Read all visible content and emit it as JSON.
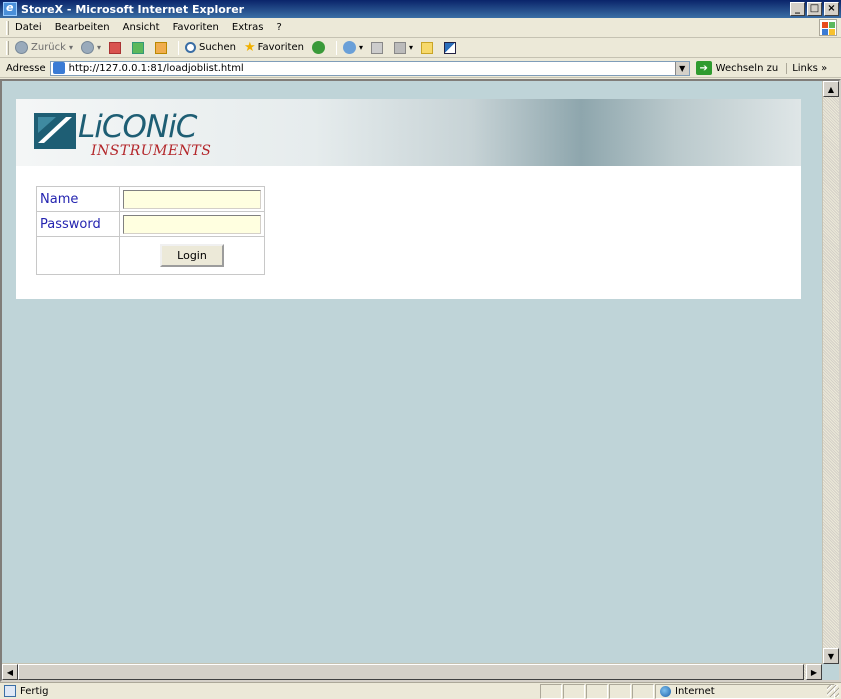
{
  "window": {
    "title": "StoreX - Microsoft Internet Explorer"
  },
  "menubar": {
    "items": [
      "Datei",
      "Bearbeiten",
      "Ansicht",
      "Favoriten",
      "Extras",
      "?"
    ]
  },
  "toolbar": {
    "back": "Zurück",
    "search": "Suchen",
    "favorites": "Favoriten"
  },
  "address": {
    "label": "Adresse",
    "url": "http://127.0.0.1:81/loadjoblist.html",
    "go": "Wechseln zu",
    "links": "Links"
  },
  "page": {
    "logo": {
      "text": "LiCONiC",
      "sub": "INSTRUMENTS"
    },
    "login": {
      "name_label": "Name",
      "password_label": "Password",
      "name_value": "",
      "password_value": "",
      "button": "Login"
    }
  },
  "statusbar": {
    "text": "Fertig",
    "zone": "Internet"
  },
  "colors": {
    "background": "#bfd4d8",
    "label": "#2424b0",
    "input_bg": "#ffffe0",
    "title_bar": "#0a246a"
  }
}
